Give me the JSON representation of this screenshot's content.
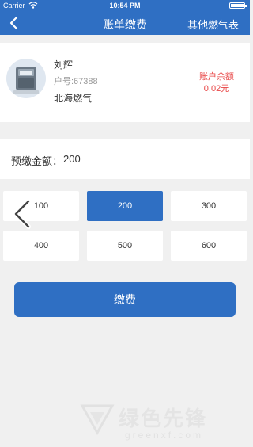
{
  "status_bar": {
    "carrier": "Carrier",
    "time": "10:54 PM"
  },
  "nav": {
    "title": "账单缴费",
    "right_action": "其他燃气表"
  },
  "account": {
    "name": "刘辉",
    "house_no": "户号:67388",
    "company": "北海燃气",
    "balance_label": "账户余额",
    "balance_value": "0.02元"
  },
  "prepay": {
    "label": "预缴金额：",
    "value": "200"
  },
  "amounts": [
    {
      "label": "100",
      "selected": false
    },
    {
      "label": "200",
      "selected": true
    },
    {
      "label": "300",
      "selected": false
    },
    {
      "label": "400",
      "selected": false
    },
    {
      "label": "500",
      "selected": false
    },
    {
      "label": "600",
      "selected": false
    }
  ],
  "pay_button": {
    "label": "缴费"
  },
  "watermark": {
    "text": "绿色先锋",
    "url": "greenxf.com"
  },
  "colors": {
    "primary": "#2f6fc3",
    "balance": "#e84545",
    "background": "#f0f0f0"
  }
}
